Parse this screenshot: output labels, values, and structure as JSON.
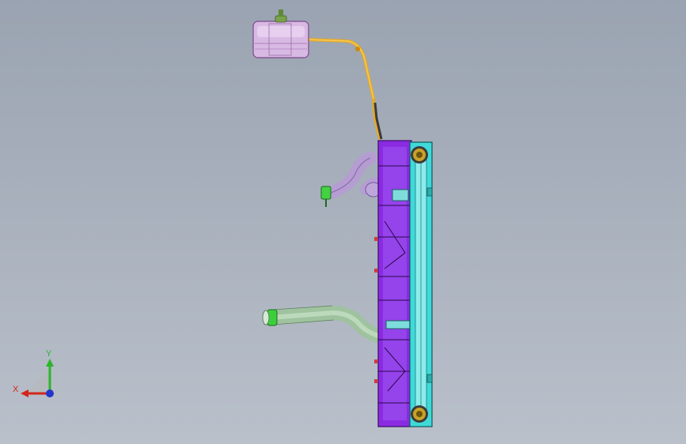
{
  "viewport": {
    "background_top": "#9aa3b1",
    "background_bottom": "#b9c0ca"
  },
  "model": {
    "parts": [
      {
        "name": "expansion-tank",
        "color": "#d9b8e6"
      },
      {
        "name": "overflow-hose",
        "color": "#f0b429"
      },
      {
        "name": "radiator-tank-left",
        "color": "#8a2be2"
      },
      {
        "name": "radiator-core",
        "color": "#3fd9d9"
      },
      {
        "name": "upper-hose",
        "color": "#b79ad8"
      },
      {
        "name": "lower-hose",
        "color": "#a8c8a8"
      },
      {
        "name": "hose-clamp",
        "color": "#3ccf3c"
      },
      {
        "name": "mount-bushing",
        "color": "#c9a227"
      }
    ]
  },
  "triad": {
    "x_label": "X",
    "y_label": "Y",
    "x_color": "#d4261c",
    "y_color": "#2bb52b",
    "z_color": "#2435c8"
  }
}
